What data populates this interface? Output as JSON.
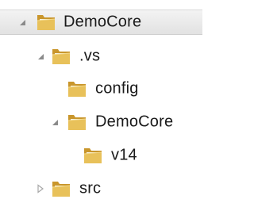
{
  "tree": {
    "nodes": [
      {
        "label": "DemoCore",
        "state": "expanded",
        "selected": true
      },
      {
        "label": ".vs",
        "state": "expanded",
        "selected": false
      },
      {
        "label": "config",
        "state": "leaf",
        "selected": false
      },
      {
        "label": "DemoCore",
        "state": "expanded",
        "selected": false
      },
      {
        "label": "v14",
        "state": "leaf",
        "selected": false
      },
      {
        "label": "src",
        "state": "collapsed",
        "selected": false
      }
    ]
  },
  "colors": {
    "folder_front": "#e8c15a",
    "folder_back": "#c9962c",
    "folder_paper": "#f7f2e2",
    "expander": "#8a8a8a"
  },
  "icons": {
    "folder": "folder-icon",
    "expanded": "triangle-expanded-icon",
    "collapsed": "triangle-collapsed-icon"
  }
}
